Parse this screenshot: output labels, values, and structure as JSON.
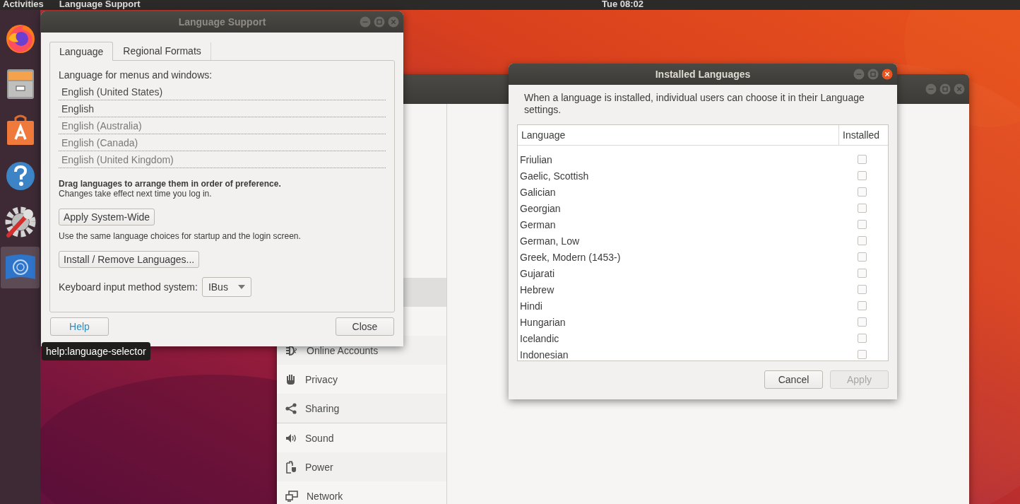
{
  "top_bar": {
    "activities": "Activities",
    "app_menu": "Language Support",
    "clock": "Tue 08:02"
  },
  "dock": [
    {
      "kind": "browser",
      "selected": false
    },
    {
      "kind": "files",
      "selected": false
    },
    {
      "kind": "software",
      "selected": false
    },
    {
      "kind": "help",
      "selected": false
    },
    {
      "kind": "tools",
      "selected": false
    },
    {
      "kind": "language",
      "selected": true
    }
  ],
  "language_support": {
    "title": "Language Support",
    "tabs": [
      {
        "label": "Language",
        "selected": true
      },
      {
        "label": "Regional Formats",
        "selected": false
      }
    ],
    "heading": "Language for menus and windows:",
    "languages": [
      {
        "label": "English (United States)",
        "disabled": false
      },
      {
        "label": "English",
        "disabled": false
      },
      {
        "label": "English (Australia)",
        "disabled": true
      },
      {
        "label": "English (Canada)",
        "disabled": true
      },
      {
        "label": "English (United Kingdom)",
        "disabled": true
      }
    ],
    "drag_hint": "Drag languages to arrange them in order of preference.",
    "changes_note": "Changes take effect next time you log in.",
    "apply_button": "Apply System-Wide",
    "apply_note": "Use the same language choices for startup and the login screen.",
    "install_button": "Install / Remove Languages...",
    "keyboard_label": "Keyboard input method system:",
    "keyboard_value": "IBus",
    "help_button": "Help",
    "close_button": "Close"
  },
  "tooltip": "help:language-selector",
  "settings": {
    "sidebar": [
      {
        "kind": "accounts",
        "label": "Online Accounts"
      },
      {
        "kind": "privacy",
        "label": "Privacy"
      },
      {
        "kind": "sharing",
        "label": "Sharing"
      },
      {
        "kind": "sound",
        "label": "Sound"
      },
      {
        "kind": "power",
        "label": "Power"
      },
      {
        "kind": "network",
        "label": "Network"
      }
    ]
  },
  "installed_languages": {
    "title": "Installed Languages",
    "description": "When a language is installed, individual users can choose it in their Language settings.",
    "columns": [
      "Language",
      "Installed"
    ],
    "rows": [
      {
        "name": "Friulian",
        "checked": false
      },
      {
        "name": "Gaelic, Scottish",
        "checked": false
      },
      {
        "name": "Galician",
        "checked": false
      },
      {
        "name": "Georgian",
        "checked": false
      },
      {
        "name": "German",
        "checked": false
      },
      {
        "name": "German, Low",
        "checked": false
      },
      {
        "name": "Greek, Modern (1453-)",
        "checked": false
      },
      {
        "name": "Gujarati",
        "checked": false
      },
      {
        "name": "Hebrew",
        "checked": false
      },
      {
        "name": "Hindi",
        "checked": false
      },
      {
        "name": "Hungarian",
        "checked": false
      },
      {
        "name": "Icelandic",
        "checked": false
      },
      {
        "name": "Indonesian",
        "checked": false
      }
    ],
    "cancel_button": {
      "label": "Cancel",
      "disabled": false
    },
    "apply_button": {
      "label": "Apply",
      "disabled": true
    }
  }
}
